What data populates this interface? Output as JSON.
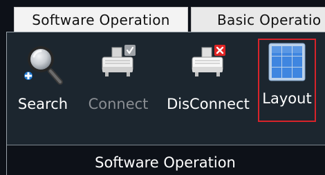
{
  "tabs": [
    {
      "label": "Software Operation",
      "active": true
    },
    {
      "label": "Basic Operatio",
      "active": false
    }
  ],
  "ribbon": {
    "buttons": [
      {
        "id": "search",
        "label": "Search",
        "icon": "magnifier-icon",
        "enabled": true
      },
      {
        "id": "connect",
        "label": "Connect",
        "icon": "device-check-icon",
        "enabled": false
      },
      {
        "id": "disconnect",
        "label": "DisConnect",
        "icon": "device-x-icon",
        "enabled": true
      },
      {
        "id": "layout",
        "label": "Layout",
        "icon": "grid-layout-icon",
        "enabled": true,
        "highlighted": true
      }
    ],
    "group_caption": "Software Operation"
  },
  "colors": {
    "background": "#0d1118",
    "panel": "#1c262f",
    "highlight_border": "#d8232a",
    "disabled_text": "#8a8e93",
    "layout_tile": "#3f86e0"
  }
}
